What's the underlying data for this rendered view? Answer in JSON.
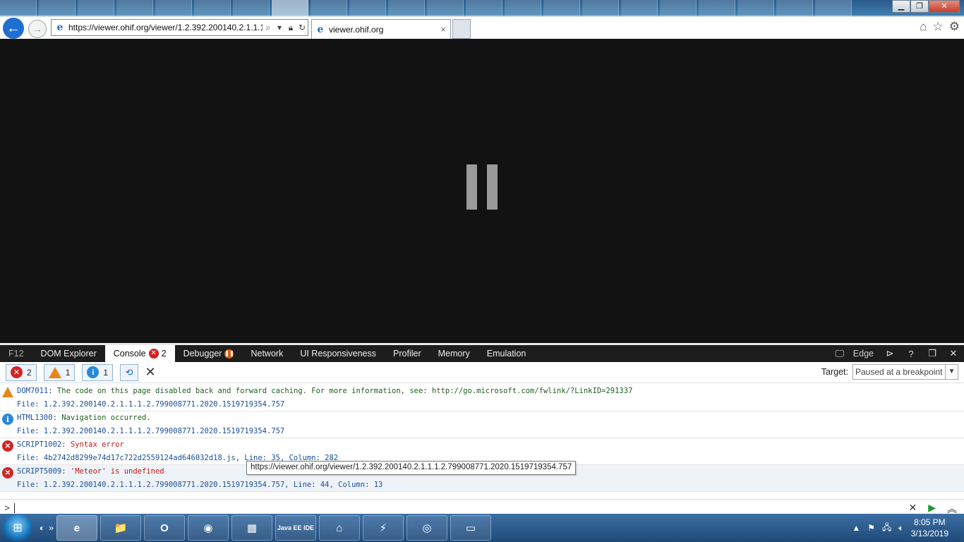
{
  "browser": {
    "url": "https://viewer.ohif.org/viewer/1.2.392.200140.2.1.1.1.2.799008771.2020.1519719354.757",
    "tab_title": "viewer.ohif.org",
    "tab_close": "×"
  },
  "devtools": {
    "tabs": [
      {
        "label": "F12"
      },
      {
        "label": "DOM Explorer"
      },
      {
        "label": "Console",
        "badge": "2"
      },
      {
        "label": "Debugger"
      },
      {
        "label": "Network"
      },
      {
        "label": "UI Responsiveness"
      },
      {
        "label": "Profiler"
      },
      {
        "label": "Memory"
      },
      {
        "label": "Emulation"
      }
    ],
    "document_mode": "Edge",
    "filters": {
      "errors": "2",
      "warnings": "1",
      "messages": "1"
    },
    "target_label": "Target:",
    "target_value": "Paused at a breakpoint",
    "messages": [
      {
        "type": "warning",
        "code": "DOM7011",
        "text": "The code on this page disabled back and forward caching. For more information, see: http://go.microsoft.com/fwlink/?LinkID=291337",
        "file": "File: 1.2.392.200140.2.1.1.1.2.799008771.2020.1519719354.757"
      },
      {
        "type": "info",
        "code": "HTML1300",
        "text": "Navigation occurred.",
        "file": "File: 1.2.392.200140.2.1.1.1.2.799008771.2020.1519719354.757"
      },
      {
        "type": "error",
        "code": "SCRIPT1002",
        "text": "Syntax error",
        "file": "File: 4b2742d8299e74d17c722d2559124ad646032d18.js, Line: 35, Column: 282"
      },
      {
        "type": "error",
        "code": "SCRIPT5009",
        "text": "'Meteor' is undefined",
        "file": "File: 1.2.392.200140.2.1.1.1.2.799008771.2020.1519719354.757, Line: 44, Column: 13"
      }
    ],
    "tooltip": "https://viewer.ohif.org/viewer/1.2.392.200140.2.1.1.1.2.799008771.2020.1519719354.757",
    "prompt": ">"
  },
  "taskbar": {
    "apps": [
      "e",
      "📁",
      "O",
      "◉",
      "▦",
      "Java EE IDE",
      "⌂",
      "⚡",
      "◎",
      "▭"
    ],
    "time": "8:05 PM",
    "date": "3/13/2019"
  },
  "icons": {
    "back": "arrow-left-icon",
    "forward": "arrow-right-icon",
    "search": "search-icon",
    "lock": "lock-icon",
    "refresh": "refresh-icon",
    "home": "home-icon",
    "favorites": "star-icon",
    "settings": "gear-icon"
  }
}
